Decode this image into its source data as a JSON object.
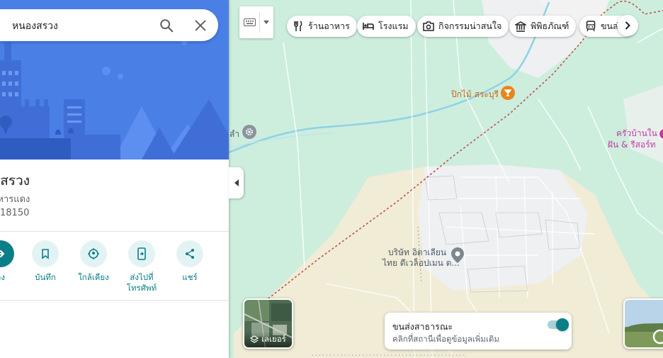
{
  "search": {
    "query": "หนองสรวง"
  },
  "place": {
    "title": "งสรวง",
    "subtitle": "งิหารแดง",
    "postal": "18150"
  },
  "actions": [
    {
      "label": "าง",
      "icon": "directions-icon"
    },
    {
      "label": "บันทึก",
      "icon": "bookmark-icon"
    },
    {
      "label": "ใกล้เคียง",
      "icon": "nearby-icon"
    },
    {
      "label": "ส่งไปที่\nโทรศัพท์",
      "label_line1": "ส่งไปที่",
      "label_line2": "โทรศัพท์",
      "icon": "send-to-phone-icon"
    },
    {
      "label": "แชร์",
      "icon": "share-icon"
    }
  ],
  "chips": [
    {
      "label": "ร้านอาหาร",
      "icon": "restaurant-icon"
    },
    {
      "label": "โรงแรม",
      "icon": "hotel-icon"
    },
    {
      "label": "กิจกรรมน่าสนใจ",
      "icon": "camera-icon"
    },
    {
      "label": "พิพิธภัณฑ์",
      "icon": "museum-icon"
    },
    {
      "label": "ขนส่",
      "icon": "transit-icon"
    }
  ],
  "map_labels": {
    "poi_orange": "ปิกไม้ สระบุรี",
    "poi_gray_line1": "บริษัท อิตาเลียน",
    "poi_gray_line2": "ไทย ดีเวล็อปเมน ต...",
    "poi_pink_line1": "ครัวบ้านใน",
    "poi_pink_line2": "ฝัน & รีสอร์ท",
    "edge_label": "ลำ"
  },
  "layers": {
    "label": "เลเยอร์"
  },
  "transit_card": {
    "title": "ขนส่งสาธารณะ",
    "subtitle": "คลิกที่สถานีเพื่อดูข้อมูลเพิ่มเติม",
    "enabled": true
  },
  "colors": {
    "accent": "#0b7f88",
    "hero_blue": "#4a7fe6",
    "park_green": "#cdeedd",
    "sand": "#f1ecd6",
    "river": "#8fd2e6",
    "rail": "#c0504d",
    "poi_orange": "#e8861d",
    "poi_pink": "#c23ca3"
  }
}
